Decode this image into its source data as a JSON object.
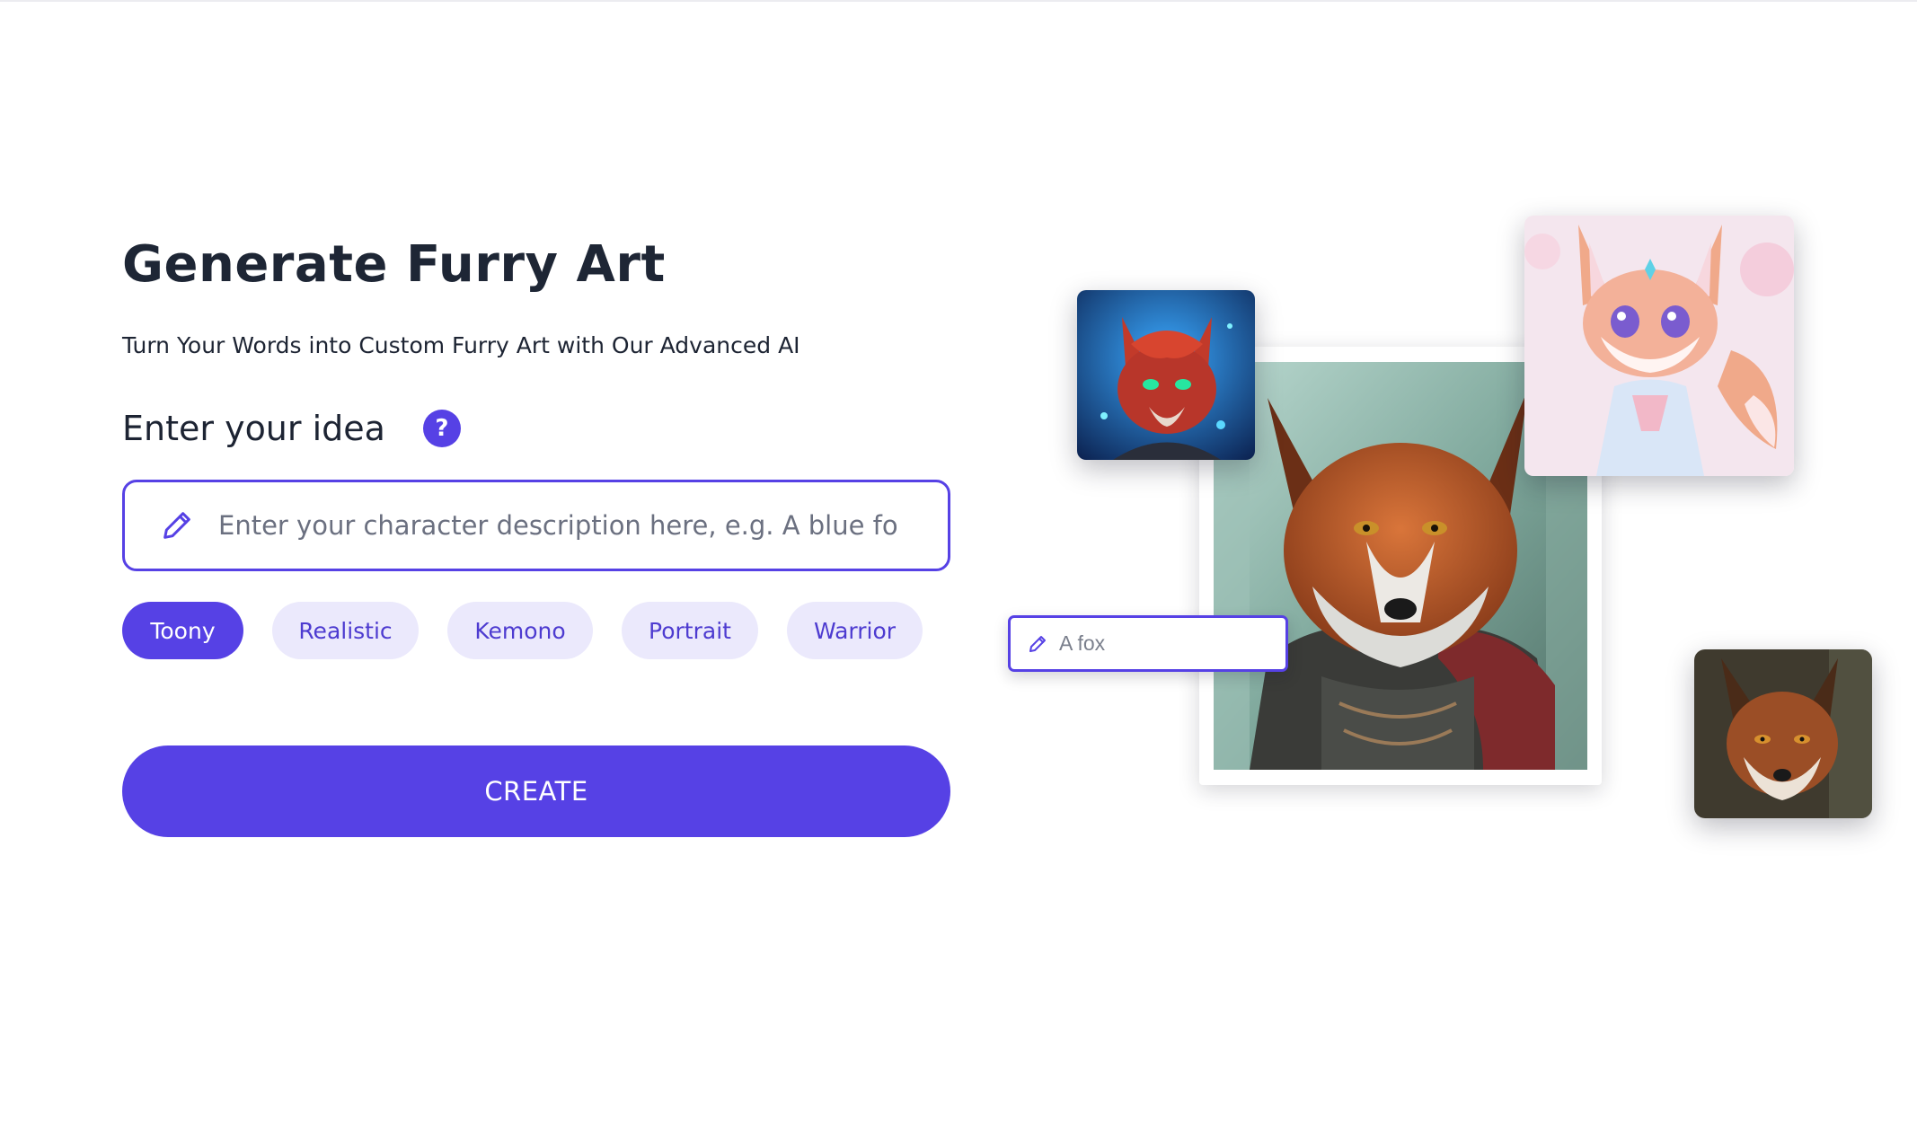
{
  "hero": {
    "title": "Generate Furry Art",
    "subtitle": "Turn Your Words into Custom Furry Art with Our Advanced AI",
    "idea_label": "Enter your idea",
    "help_icon": "question-mark-icon",
    "help_symbol": "?"
  },
  "prompt": {
    "placeholder": "Enter your character description here, e.g. A blue fox with",
    "value": "",
    "icon": "pencil-icon"
  },
  "styles": [
    {
      "label": "Toony",
      "selected": true
    },
    {
      "label": "Realistic",
      "selected": false
    },
    {
      "label": "Kemono",
      "selected": false
    },
    {
      "label": "Portrait",
      "selected": false
    },
    {
      "label": "Warrior",
      "selected": false
    }
  ],
  "create_button": {
    "label": "CREATE"
  },
  "showcase": {
    "mini_prompt_text": "A fox",
    "images": [
      "armored-fox-warrior-image",
      "blue-neon-fox-image",
      "pink-anime-fox-image",
      "realistic-red-fox-image"
    ]
  },
  "colors": {
    "accent": "#5641e5",
    "chip_bg": "#ebe9fc",
    "chip_text": "#4d3bd0",
    "heading": "#1e2635"
  }
}
